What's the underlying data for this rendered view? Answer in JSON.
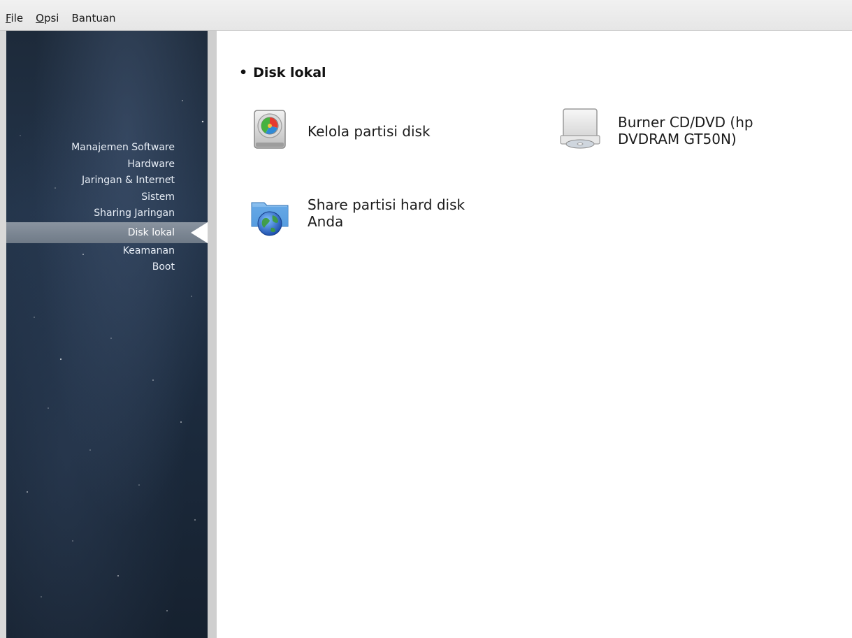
{
  "menubar": {
    "items": [
      {
        "mnemonic": "F",
        "rest": "ile"
      },
      {
        "mnemonic": "O",
        "rest": "psi"
      },
      {
        "mnemonic": "",
        "rest": "Bantuan"
      }
    ]
  },
  "sidebar": {
    "items": [
      {
        "label": "Manajemen Software",
        "active": false
      },
      {
        "label": "Hardware",
        "active": false
      },
      {
        "label": "Jaringan & Internet",
        "active": false
      },
      {
        "label": "Sistem",
        "active": false
      },
      {
        "label": "Sharing Jaringan",
        "active": false
      },
      {
        "label": "Disk lokal",
        "active": true
      },
      {
        "label": "Keamanan",
        "active": false
      },
      {
        "label": "Boot",
        "active": false
      }
    ]
  },
  "main": {
    "section_bullet": "•",
    "section_title": "Disk lokal",
    "tools": [
      {
        "label": "Kelola partisi disk",
        "icon": "hard-disk-partition-icon"
      },
      {
        "label": "Burner CD/DVD (hp DVDRAM GT50N)",
        "icon": "optical-drive-icon"
      },
      {
        "label": "Share partisi hard disk Anda",
        "icon": "network-folder-icon"
      }
    ]
  },
  "colors": {
    "sidebar_bg": "#1d2a3a",
    "active_item": "#7c8692",
    "sidebar_text": "#e8eef6"
  }
}
